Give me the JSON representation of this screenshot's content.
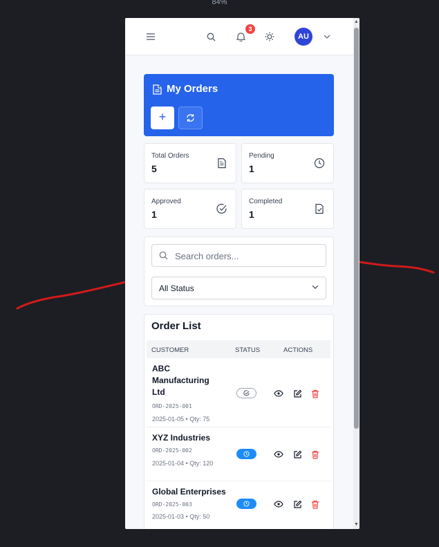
{
  "zoom": "84%",
  "header": {
    "notification_count": "3",
    "avatar_initials": "AU"
  },
  "page": {
    "title": "My Orders"
  },
  "stats": [
    {
      "label": "Total Orders",
      "value": "5",
      "icon": "document-icon"
    },
    {
      "label": "Pending",
      "value": "1",
      "icon": "clock-icon"
    },
    {
      "label": "Approved",
      "value": "1",
      "icon": "check-circle-icon"
    },
    {
      "label": "Completed",
      "value": "1",
      "icon": "file-check-icon"
    }
  ],
  "filters": {
    "search_placeholder": "Search orders...",
    "status_selected": "All Status"
  },
  "order_list": {
    "title": "Order List",
    "columns": [
      "CUSTOMER",
      "STATUS",
      "ACTIONS"
    ],
    "rows": [
      {
        "customer": "ABC Manufacturing Ltd",
        "order_id": "ORD-2025-001",
        "meta": "2025-01-05 • Qty: 75",
        "status": "approved"
      },
      {
        "customer": "XYZ Industries",
        "order_id": "ORD-2025-002",
        "meta": "2025-01-04 • Qty: 120",
        "status": "pending"
      },
      {
        "customer": "Global Enterprises",
        "order_id": "ORD-2025-003",
        "meta": "2025-01-03 • Qty: 50",
        "status": "pending"
      }
    ]
  },
  "colors": {
    "primary": "#2563eb",
    "danger": "#ef4444",
    "pending": "#1d8cf8",
    "annotation": "#d11a1a"
  }
}
